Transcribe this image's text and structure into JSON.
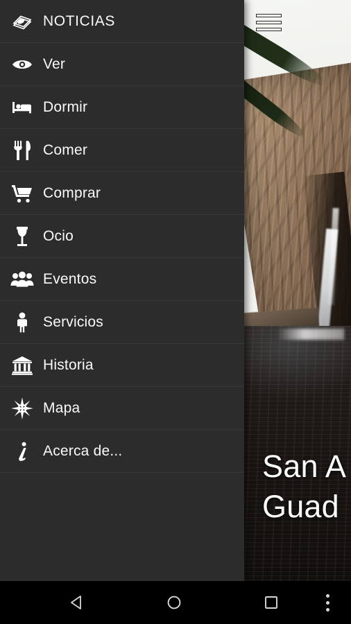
{
  "app": {
    "hero_title_line1": "San A",
    "hero_title_line2": "Guad",
    "hero_title_full": "San A… Guad…"
  },
  "toolbar": {
    "menu_icon": "hamburger-icon",
    "menu_label": "Abrir menú"
  },
  "drawer": {
    "items": [
      {
        "id": "noticias",
        "label": "NOTICIAS",
        "icon": "newspapers-icon",
        "caps": true
      },
      {
        "id": "ver",
        "label": "Ver",
        "icon": "eye-icon",
        "caps": false
      },
      {
        "id": "dormir",
        "label": "Dormir",
        "icon": "bed-icon",
        "caps": false
      },
      {
        "id": "comer",
        "label": "Comer",
        "icon": "cutlery-icon",
        "caps": false
      },
      {
        "id": "comprar",
        "label": "Comprar",
        "icon": "shopping-cart-icon",
        "caps": false
      },
      {
        "id": "ocio",
        "label": "Ocio",
        "icon": "wine-glass-icon",
        "caps": false
      },
      {
        "id": "eventos",
        "label": "Eventos",
        "icon": "people-group-icon",
        "caps": false
      },
      {
        "id": "servicios",
        "label": "Servicios",
        "icon": "person-icon",
        "caps": false
      },
      {
        "id": "historia",
        "label": "Historia",
        "icon": "museum-icon",
        "caps": false
      },
      {
        "id": "mapa",
        "label": "Mapa",
        "icon": "compass-icon",
        "caps": false
      },
      {
        "id": "acerca-de",
        "label": "Acerca de...",
        "icon": "info-icon",
        "caps": false
      }
    ]
  },
  "system_nav": {
    "back_label": "Atrás",
    "home_label": "Inicio",
    "recents_label": "Recientes",
    "overflow_label": "Más opciones"
  },
  "colors": {
    "drawer_background": "#2c2c2c",
    "drawer_divider": "#373737",
    "drawer_text": "#fafafa",
    "system_nav_background": "#000000",
    "system_nav_icon": "#d8d8d8",
    "hero_title_text": "#ffffff"
  }
}
